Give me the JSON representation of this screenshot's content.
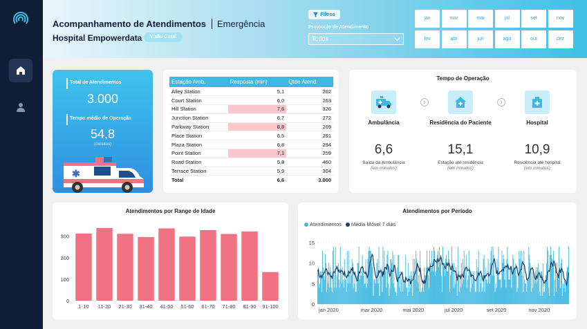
{
  "header": {
    "title": "Acompanhamento de Atendimentos",
    "subtitle": "Emergência",
    "hospital": "Hospital Empowerdata",
    "badge": "Visão Geral",
    "filter_label": "Filtros",
    "protocol_label": "Protocolo de Atendimento",
    "protocol_value": "Todos",
    "months": [
      "jan",
      "mar",
      "mai",
      "jul",
      "set",
      "nov",
      "fev",
      "abr",
      "jun",
      "ago",
      "out",
      "dez"
    ]
  },
  "sidebar": {
    "icons": [
      "logo-icon",
      "home-icon",
      "user-icon"
    ]
  },
  "kpis": {
    "total_label": "Total de Atendimentos",
    "total_value": "3.000",
    "avg_label": "Tempo médio de Operação",
    "avg_value": "54,8",
    "avg_unit": "(minutos)"
  },
  "table": {
    "headers": [
      "Estação Amb.",
      "Resposta (min)",
      "Qtde Atend."
    ],
    "rows": [
      {
        "station": "Alley Station",
        "resp": "5,1",
        "qty": "262",
        "hl": false
      },
      {
        "station": "Court Station",
        "resp": "6,0",
        "qty": "263",
        "hl": false
      },
      {
        "station": "Hill Station",
        "resp": "7,6",
        "qty": "326",
        "hl": true
      },
      {
        "station": "Junction Station",
        "resp": "6,7",
        "qty": "272",
        "hl": false
      },
      {
        "station": "Parkway Station",
        "resp": "8,8",
        "qty": "269",
        "hl": true
      },
      {
        "station": "Place Station",
        "resp": "6,5",
        "qty": "291",
        "hl": false
      },
      {
        "station": "Plaza Station",
        "resp": "6,8",
        "qty": "294",
        "hl": false
      },
      {
        "station": "Point Station",
        "resp": "7,1",
        "qty": "259",
        "hl": true
      },
      {
        "station": "Road Station",
        "resp": "5,8",
        "qty": "460",
        "hl": false
      },
      {
        "station": "Terrace Station",
        "resp": "5,9",
        "qty": "304",
        "hl": false
      }
    ],
    "total": {
      "station": "Total",
      "resp": "6,6",
      "qty": "3.000"
    }
  },
  "operation": {
    "title": "Tempo de Operação",
    "items": [
      {
        "label": "Ambulância",
        "value": "6,6",
        "desc": "Saída da Ambulância",
        "unit": "(em minutos)",
        "icon": "ambulance-icon"
      },
      {
        "label": "Residência do Paciente",
        "value": "15,1",
        "desc": "Estação até residência",
        "unit": "(em minutos)",
        "icon": "house-icon"
      },
      {
        "label": "Hospital",
        "value": "10,9",
        "desc": "Residência até hospital",
        "unit": "(em minutos)",
        "icon": "hospital-icon"
      }
    ],
    "accent": "#3db8e0"
  },
  "chart_data": [
    {
      "type": "bar",
      "title": "Atendimentos por Range de Idade",
      "categories": [
        "1-10",
        "11-20",
        "21-30",
        "31-40",
        "41-50",
        "51-60",
        "61-70",
        "71-80",
        "81-90",
        "91-100"
      ],
      "values": [
        312,
        338,
        311,
        296,
        336,
        298,
        328,
        310,
        322,
        133
      ],
      "yticks": [
        0,
        100,
        200,
        300
      ],
      "ylim": [
        0,
        360
      ],
      "color": "#f07280"
    },
    {
      "type": "bar",
      "title": "Atendimentos por Período",
      "series": [
        {
          "name": "Atendimentos",
          "color": "#3db8e0"
        },
        {
          "name": "Média Móvel 7 dias",
          "color": "#1f3a63"
        }
      ],
      "x_ticks": [
        "jan 2020",
        "mar 2020",
        "mai 2020",
        "jul 2020",
        "set 2020",
        "nov 2020"
      ],
      "yticks": [
        0,
        5,
        10,
        15
      ],
      "ylim": [
        0,
        16
      ],
      "days": 366,
      "moving_avg_level": 8.2
    }
  ]
}
